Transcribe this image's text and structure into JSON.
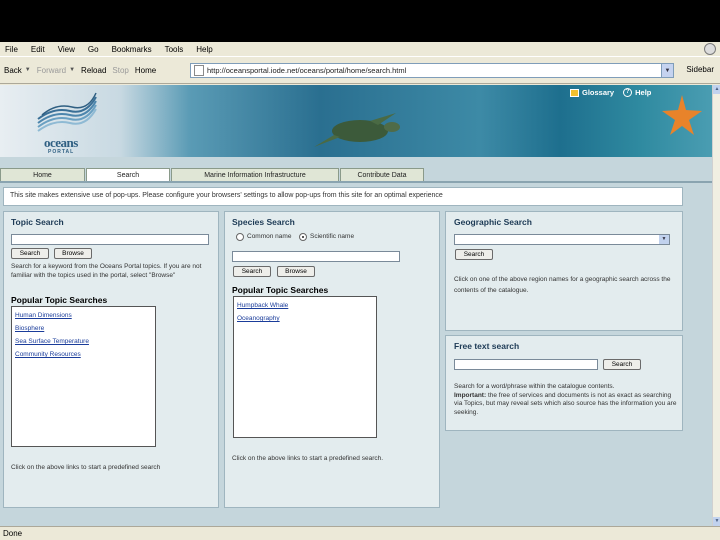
{
  "menubar": {
    "items": [
      "File",
      "Edit",
      "View",
      "Go",
      "Bookmarks",
      "Tools",
      "Help"
    ]
  },
  "navbar": {
    "back": "Back",
    "forward": "Forward",
    "reload": "Reload",
    "stop": "Stop",
    "home": "Home",
    "url": "http://oceansportal.iode.net/oceans/portal/home/search.html",
    "right_label": "Sidebar"
  },
  "banner": {
    "logo_text": "oceans",
    "logo_sub": "PORTAL",
    "glossary": "Glossary",
    "help": "Help"
  },
  "tabs": [
    "Home",
    "Search",
    "Marine Information Infrastructure",
    "Contribute Data"
  ],
  "notice": "This site makes extensive use of pop-ups. Please configure your browsers' settings to allow pop-ups from this site for an optimal experience",
  "topic": {
    "title": "Topic Search",
    "search_btn": "Search",
    "browse_btn": "Browse",
    "help": "Search for a keyword from the Oceans Portal topics. If you are not familiar with the topics used in the portal, select \"Browse\"",
    "popular_title": "Popular Topic Searches",
    "links": [
      "Human Dimensions",
      "Biosphere",
      "Sea Surface Temperature",
      "Community Resources"
    ],
    "footer": "Click on the above links to start a predefined search"
  },
  "species": {
    "title": "Species Search",
    "radio_common": "Common name",
    "radio_scientific": "Scientific name",
    "search_btn": "Search",
    "browse_btn": "Browse",
    "popular_title": "Popular Topic Searches",
    "links": [
      "Humpback Whale",
      "Oceanography"
    ],
    "footer": "Click on the above links to start a predefined search."
  },
  "geo": {
    "title": "Geographic Search",
    "search_btn": "Search",
    "help": "Click on one of the above region names for a geographic search across the contents of the catalogue."
  },
  "freetext": {
    "title": "Free text search",
    "search_btn": "Search",
    "help_line1": "Search for a word/phrase within the catalogue contents.",
    "important_label": "Important:",
    "help_line2": "the free of services and documents is not as exact as searching via Topics, but may reveal sets which also source has the information you are seeking."
  },
  "status": "Done"
}
